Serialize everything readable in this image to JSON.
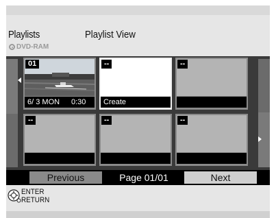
{
  "header": {
    "title": "Playlists",
    "subtitle": "Playlist View",
    "disc": "DVD-RAM",
    "disc_icon": "disc-icon"
  },
  "grid": {
    "tiles": [
      {
        "number": "01",
        "date": "6/ 3 MON",
        "duration": "0:30",
        "state": "thumbnail"
      },
      {
        "number": "--",
        "label": "Create",
        "state": "selected"
      },
      {
        "number": "--",
        "label": "",
        "state": "empty"
      },
      {
        "number": "--",
        "label": "",
        "state": "empty"
      },
      {
        "number": "--",
        "label": "",
        "state": "empty"
      },
      {
        "number": "--",
        "label": "",
        "state": "empty"
      }
    ],
    "left_arrow_icon": "triangle-left-icon",
    "right_arrow_icon": "triangle-right-icon"
  },
  "footer": {
    "previous": "Previous",
    "page": "Page 01/01",
    "next": "Next"
  },
  "help": {
    "enter": "ENTER",
    "return": "RETURN",
    "icon": "remote-dpad-icon"
  }
}
